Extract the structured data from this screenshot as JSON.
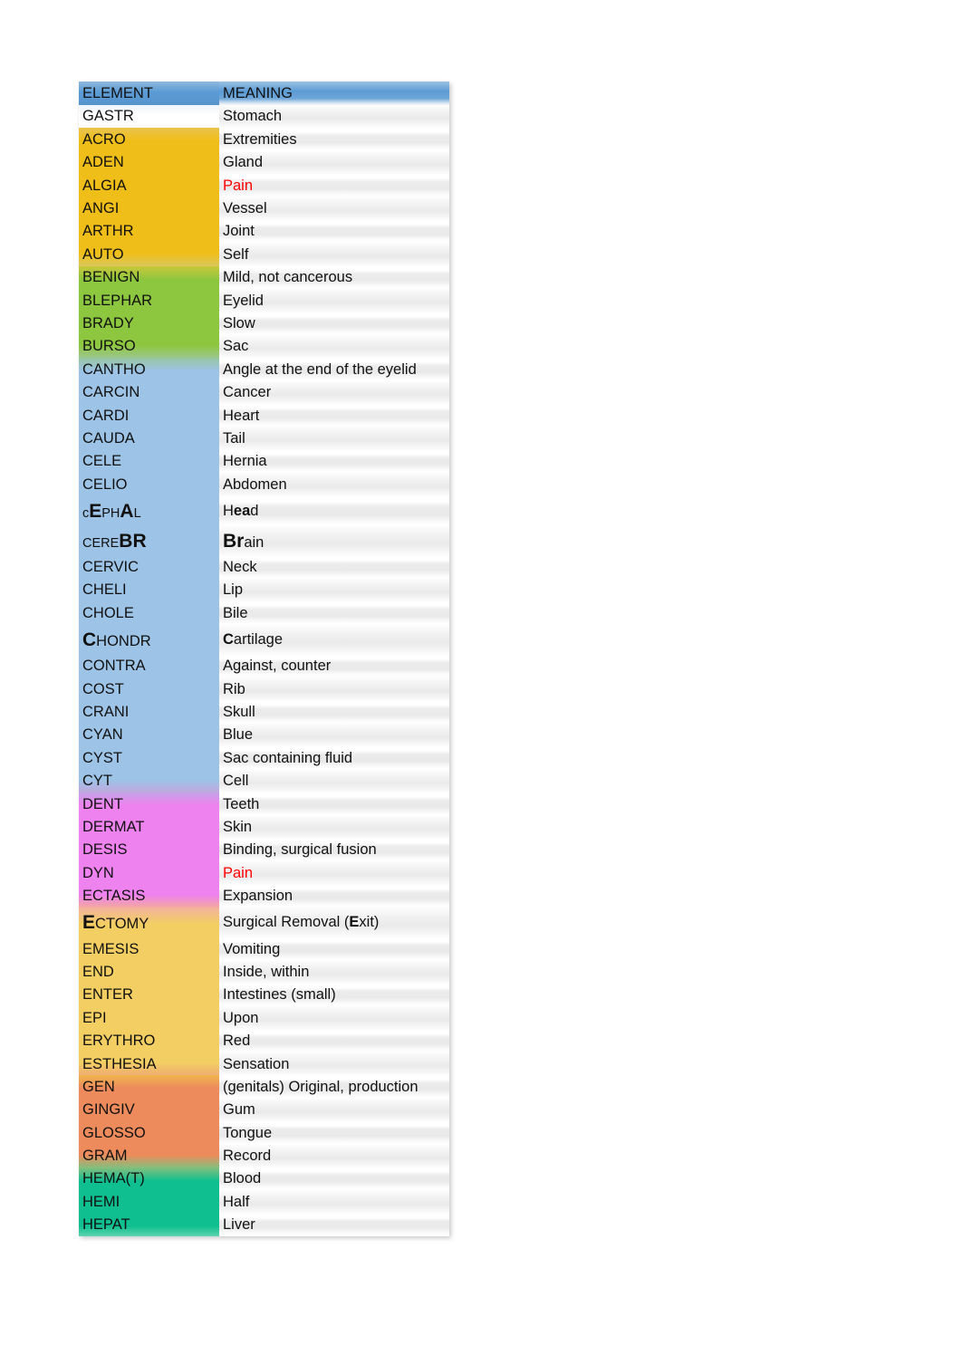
{
  "table": {
    "columns": [
      "ELEMENT",
      "MEANING"
    ],
    "colors": {
      "header_blue": "#5B9BD5",
      "gold": "#F0BE19",
      "green": "#8DC63F",
      "blue": "#9DC3E6",
      "pink": "#EE82EE",
      "light_gold": "#F3CE63",
      "orange": "#ED8B5C",
      "teal": "#0FBF8F",
      "pain_red": "#FF0000"
    },
    "rows": [
      {
        "element": "GASTR",
        "meaning": "Stomach",
        "fill": "none"
      },
      {
        "element": "ACRO",
        "meaning": "Extremities",
        "fill": "gold"
      },
      {
        "element": "ADEN",
        "meaning": "Gland",
        "fill": "gold"
      },
      {
        "element": "ALGIA",
        "meaning": "Pain",
        "fill": "gold",
        "meaning_color": "#FF0000"
      },
      {
        "element": "ANGI",
        "meaning": "Vessel",
        "fill": "gold"
      },
      {
        "element": "ARTHR",
        "meaning": "Joint",
        "fill": "gold"
      },
      {
        "element": "AUTO",
        "meaning": "Self",
        "fill": "gold"
      },
      {
        "element": "BENIGN",
        "meaning": "Mild, not cancerous",
        "fill": "green"
      },
      {
        "element": "BLEPHAR",
        "meaning": "Eyelid",
        "fill": "green"
      },
      {
        "element": "BRADY",
        "meaning": "Slow",
        "fill": "green"
      },
      {
        "element": "BURSO",
        "meaning": "Sac",
        "fill": "green"
      },
      {
        "element": "CANTHO",
        "meaning": "Angle at the end of the eyelid",
        "fill": "blue"
      },
      {
        "element": "CARCIN",
        "meaning": "Cancer",
        "fill": "blue"
      },
      {
        "element": "CARDI",
        "meaning": "Heart",
        "fill": "blue"
      },
      {
        "element": "CAUDA",
        "meaning": "Tail",
        "fill": "blue"
      },
      {
        "element": "CELE",
        "meaning": "Hernia",
        "fill": "blue"
      },
      {
        "element": "CELIO",
        "meaning": "Abdomen",
        "fill": "blue"
      },
      {
        "element": "cEPHAL",
        "meaning": "Head",
        "fill": "blue",
        "styled": "cephal"
      },
      {
        "element": "CEREBR",
        "meaning": "Brain",
        "fill": "blue",
        "styled": "cerebr"
      },
      {
        "element": "CERVIC",
        "meaning": "Neck",
        "fill": "blue"
      },
      {
        "element": "CHELI",
        "meaning": "Lip",
        "fill": "blue"
      },
      {
        "element": "CHOLE",
        "meaning": "Bile",
        "fill": "blue"
      },
      {
        "element": "CHONDR",
        "meaning": "Cartilage",
        "fill": "blue",
        "styled": "chondr"
      },
      {
        "element": "CONTRA",
        "meaning": "Against, counter",
        "fill": "blue"
      },
      {
        "element": "COST",
        "meaning": "Rib",
        "fill": "blue"
      },
      {
        "element": "CRANI",
        "meaning": "Skull",
        "fill": "blue"
      },
      {
        "element": "CYAN",
        "meaning": "Blue",
        "fill": "blue"
      },
      {
        "element": "CYST",
        "meaning": "Sac containing fluid",
        "fill": "blue"
      },
      {
        "element": "CYT",
        "meaning": "Cell",
        "fill": "blue"
      },
      {
        "element": "DENT",
        "meaning": "Teeth",
        "fill": "pink"
      },
      {
        "element": "DERMAT",
        "meaning": "Skin",
        "fill": "pink"
      },
      {
        "element": "DESIS",
        "meaning": "Binding, surgical fusion",
        "fill": "pink"
      },
      {
        "element": "DYN",
        "meaning": "Pain",
        "fill": "pink",
        "meaning_color": "#FF0000"
      },
      {
        "element": "ECTASIS",
        "meaning": "Expansion",
        "fill": "pink"
      },
      {
        "element": "ECTOMY",
        "meaning": "Surgical Removal (Exit)",
        "fill": "lgold",
        "styled": "ectomy"
      },
      {
        "element": "EMESIS",
        "meaning": "Vomiting",
        "fill": "lgold"
      },
      {
        "element": "END",
        "meaning": "Inside, within",
        "fill": "lgold"
      },
      {
        "element": "ENTER",
        "meaning": "Intestines (small)",
        "fill": "lgold"
      },
      {
        "element": "EPI",
        "meaning": "Upon",
        "fill": "lgold"
      },
      {
        "element": "ERYTHRO",
        "meaning": "Red",
        "fill": "lgold"
      },
      {
        "element": "ESTHESIA",
        "meaning": "Sensation",
        "fill": "lgold"
      },
      {
        "element": "GEN",
        "meaning": "(genitals) Original, production",
        "fill": "orange"
      },
      {
        "element": "GINGIV",
        "meaning": "Gum",
        "fill": "orange"
      },
      {
        "element": "GLOSSO",
        "meaning": "Tongue",
        "fill": "orange"
      },
      {
        "element": "GRAM",
        "meaning": "Record",
        "fill": "orange"
      },
      {
        "element": "HEMA(T)",
        "meaning": "Blood",
        "fill": "teal"
      },
      {
        "element": "HEMI",
        "meaning": "Half",
        "fill": "teal"
      },
      {
        "element": "HEPAT",
        "meaning": "Liver",
        "fill": "teal"
      }
    ]
  }
}
